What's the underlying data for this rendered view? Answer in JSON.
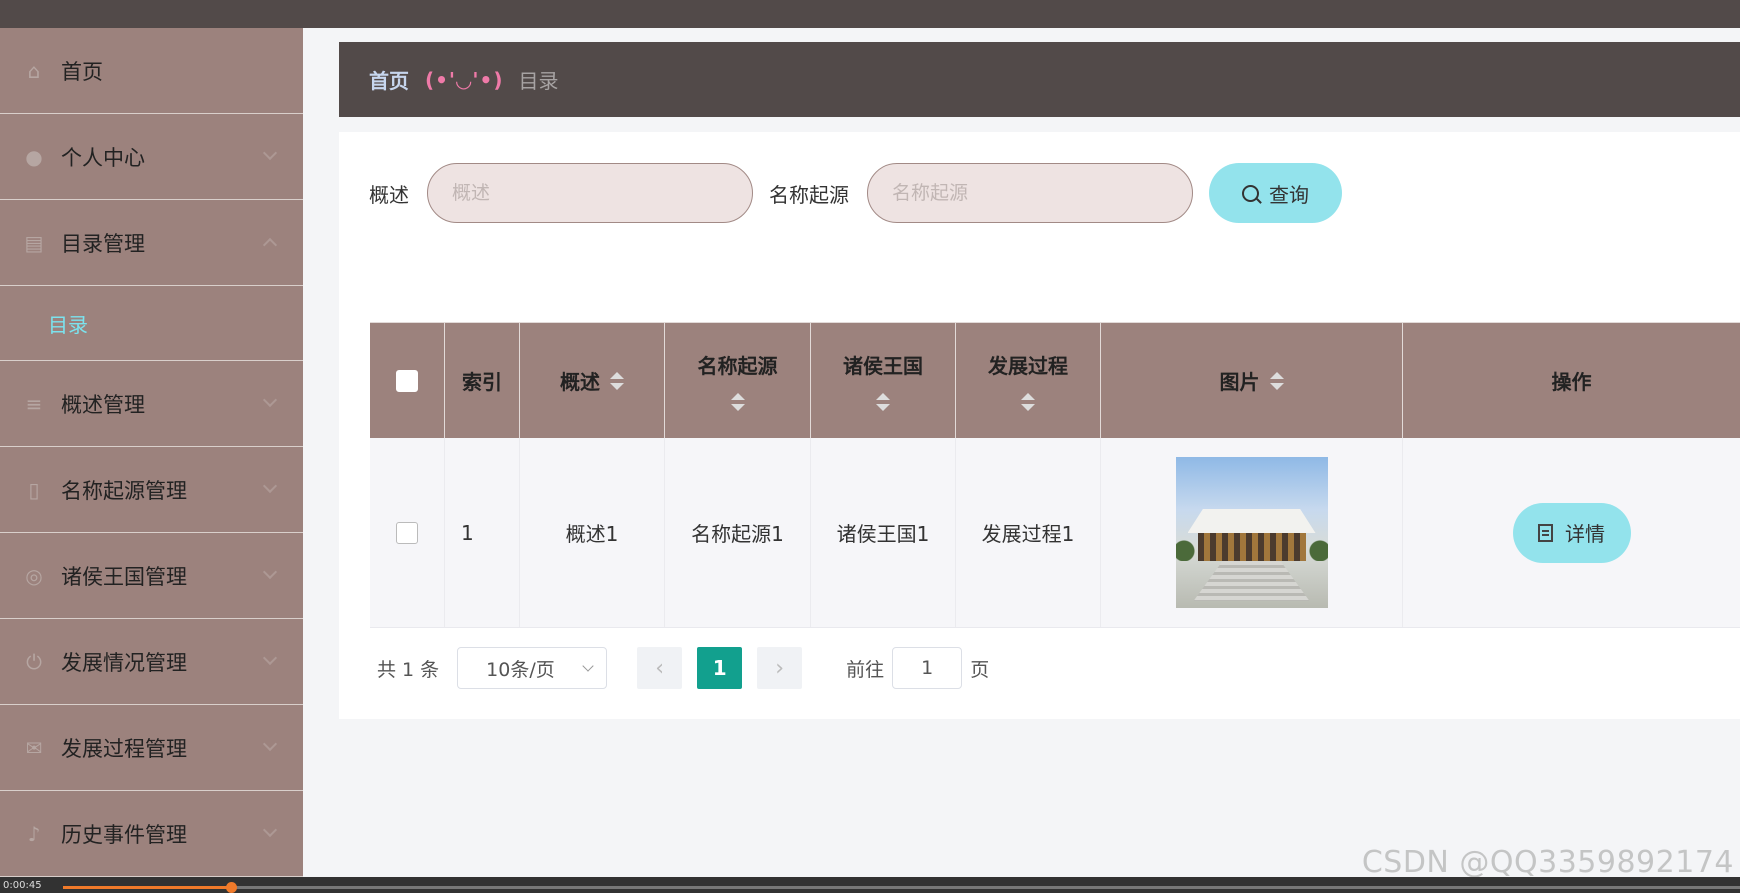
{
  "sidebar": {
    "items": [
      {
        "label": "首页",
        "icon": "home-icon",
        "glyph": "⌂",
        "chevron": "none"
      },
      {
        "label": "个人中心",
        "icon": "user-icon",
        "glyph": "●",
        "chevron": "down"
      },
      {
        "label": "目录管理",
        "icon": "chart-icon",
        "glyph": "▤",
        "chevron": "up",
        "expanded": true,
        "children": [
          {
            "label": "目录"
          }
        ]
      },
      {
        "label": "概述管理",
        "icon": "list-icon",
        "glyph": "≡",
        "chevron": "down"
      },
      {
        "label": "名称起源管理",
        "icon": "phone-icon",
        "glyph": "▯",
        "chevron": "down"
      },
      {
        "label": "诸侯王国管理",
        "icon": "compass-icon",
        "glyph": "◎",
        "chevron": "down"
      },
      {
        "label": "发展情况管理",
        "icon": "power-icon",
        "glyph": "⏻",
        "chevron": "down"
      },
      {
        "label": "发展过程管理",
        "icon": "mail-icon",
        "glyph": "✉",
        "chevron": "down"
      },
      {
        "label": "历史事件管理",
        "icon": "microphone-icon",
        "glyph": "♪",
        "chevron": "down"
      }
    ]
  },
  "breadcrumb": {
    "home": "首页",
    "separator": "(•'◡'•)",
    "current": "目录"
  },
  "search": {
    "field1_label": "概述",
    "field1_placeholder": "概述",
    "field2_label": "名称起源",
    "field2_placeholder": "名称起源",
    "query_button": "查询"
  },
  "table": {
    "headers": [
      "索引",
      "概述",
      "名称起源",
      "诸侯王国",
      "发展过程",
      "图片",
      "操作"
    ],
    "rows": [
      {
        "index": "1",
        "overview": "概述1",
        "name_origin": "名称起源1",
        "kingdom": "诸侯王国1",
        "process": "发展过程1",
        "image": "palace-photo",
        "action": "详情"
      }
    ]
  },
  "pagination": {
    "total": "共 1 条",
    "page_size": "10条/页",
    "current_page": "1",
    "goto_label": "前往",
    "goto_value": "1",
    "page_suffix": "页"
  },
  "watermark": "CSDN @QQ3359892174",
  "video": {
    "time": "0:00:45",
    "progress": 0.1
  },
  "colors": {
    "topbar": "#524a49",
    "sidebar": "#9c827d",
    "active_submenu": "#7be3ee",
    "button": "#93e3ec",
    "pager_active": "#12a08e",
    "breadcrumb_separator": "#ef7aa8"
  }
}
